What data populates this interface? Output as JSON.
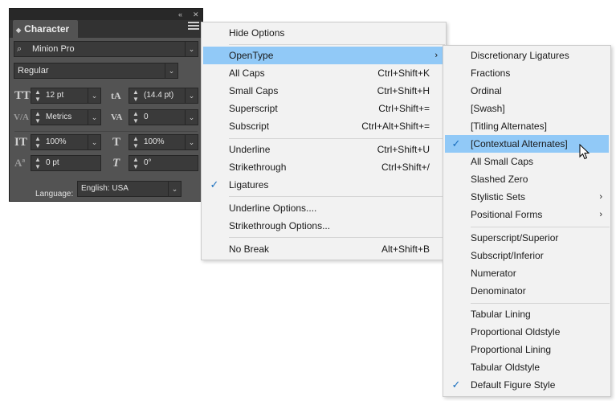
{
  "panel": {
    "title": "Character",
    "font_family": "Minion Pro",
    "font_style": "Regular",
    "font_size": "12 pt",
    "leading": "(14.4 pt)",
    "kerning": "Metrics",
    "tracking": "0",
    "vertical_scale": "100%",
    "horizontal_scale": "100%",
    "baseline_shift": "0 pt",
    "skew": "0°",
    "language_label": "Language:",
    "language_value": "English: USA"
  },
  "menu": {
    "items": [
      {
        "label": "Hide Options",
        "shortcut": ""
      },
      {
        "label": "OpenType",
        "shortcut": ""
      },
      {
        "label": "All Caps",
        "shortcut": "Ctrl+Shift+K"
      },
      {
        "label": "Small Caps",
        "shortcut": "Ctrl+Shift+H"
      },
      {
        "label": "Superscript",
        "shortcut": "Ctrl+Shift+="
      },
      {
        "label": "Subscript",
        "shortcut": "Ctrl+Alt+Shift+="
      },
      {
        "label": "Underline",
        "shortcut": "Ctrl+Shift+U"
      },
      {
        "label": "Strikethrough",
        "shortcut": "Ctrl+Shift+/"
      },
      {
        "label": "Ligatures",
        "shortcut": ""
      },
      {
        "label": "Underline Options....",
        "shortcut": ""
      },
      {
        "label": "Strikethrough Options...",
        "shortcut": ""
      },
      {
        "label": "No Break",
        "shortcut": "Alt+Shift+B"
      }
    ]
  },
  "submenu": {
    "items": [
      {
        "label": "Discretionary Ligatures"
      },
      {
        "label": "Fractions"
      },
      {
        "label": "Ordinal"
      },
      {
        "label": "[Swash]"
      },
      {
        "label": "[Titling Alternates]"
      },
      {
        "label": "[Contextual Alternates]"
      },
      {
        "label": "All Small Caps"
      },
      {
        "label": "Slashed Zero"
      },
      {
        "label": "Stylistic Sets"
      },
      {
        "label": "Positional Forms"
      },
      {
        "label": "Superscript/Superior"
      },
      {
        "label": "Subscript/Inferior"
      },
      {
        "label": "Numerator"
      },
      {
        "label": "Denominator"
      },
      {
        "label": "Tabular Lining"
      },
      {
        "label": "Proportional Oldstyle"
      },
      {
        "label": "Proportional Lining"
      },
      {
        "label": "Tabular Oldstyle"
      },
      {
        "label": "Default Figure Style"
      }
    ]
  },
  "colors": {
    "highlight": "#91c9f7",
    "menu_bg": "#f2f2f2",
    "panel_bg": "#535353",
    "check": "#1a6fbf"
  }
}
